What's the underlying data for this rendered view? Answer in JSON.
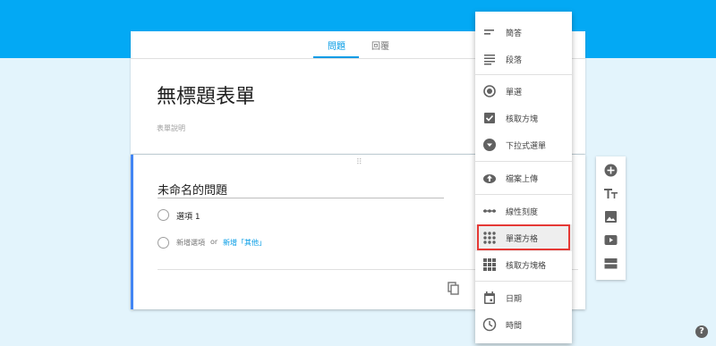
{
  "tabs": [
    {
      "label": "問題"
    },
    {
      "label": "回覆"
    }
  ],
  "form": {
    "title": "無標題表單",
    "description_placeholder": "表單說明"
  },
  "question": {
    "drag_handle": "⠿",
    "title": "未命名的問題",
    "options": [
      {
        "label": "選項 1"
      }
    ],
    "add_option": "新增選項",
    "or": "or",
    "add_other": "新增「其他」"
  },
  "menu": {
    "items": [
      {
        "label": "簡答",
        "icon": "short-text-icon"
      },
      {
        "label": "段落",
        "icon": "paragraph-icon"
      },
      {
        "label": "單選",
        "icon": "radio-icon"
      },
      {
        "label": "核取方塊",
        "icon": "checkbox-icon"
      },
      {
        "label": "下拉式選單",
        "icon": "dropdown-icon"
      },
      {
        "label": "檔案上傳",
        "icon": "upload-icon"
      },
      {
        "label": "線性刻度",
        "icon": "linear-scale-icon"
      },
      {
        "label": "單選方格",
        "icon": "grid-icon"
      },
      {
        "label": "核取方塊格",
        "icon": "checkbox-grid-icon"
      },
      {
        "label": "日期",
        "icon": "calendar-icon"
      },
      {
        "label": "時間",
        "icon": "clock-icon"
      }
    ],
    "selected": "單選方格"
  },
  "toolbar": {
    "tools": [
      "add-question-icon",
      "add-title-icon",
      "add-image-icon",
      "add-video-icon",
      "add-section-icon"
    ]
  },
  "help_label": "?",
  "colors": {
    "header": "#03a9f4",
    "background": "#e3f4fc",
    "accent": "#039be5",
    "highlight": "#e53935"
  }
}
